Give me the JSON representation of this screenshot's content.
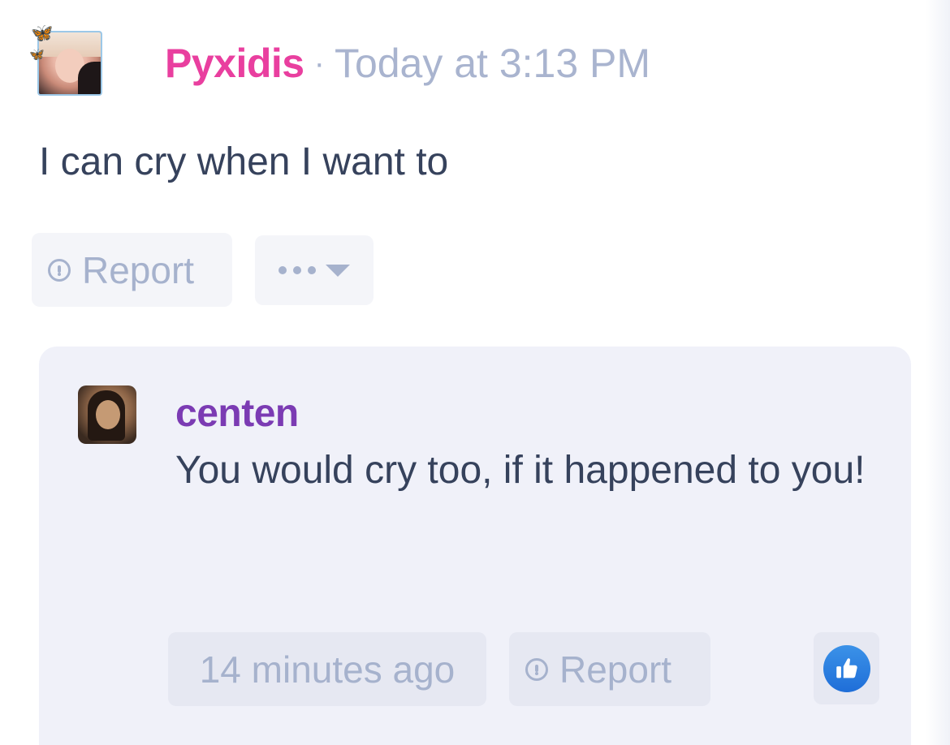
{
  "post": {
    "author": "Pyxidis",
    "separator": "·",
    "time": "Today at 3:13 PM",
    "body": "I can cry when I want to",
    "actions": {
      "report_label": "Report",
      "more_label": "•••"
    }
  },
  "reply": {
    "author": "centen",
    "body": "You would cry too, if it happened to you!",
    "time": "14 minutes ago",
    "report_label": "Report"
  },
  "colors": {
    "author_pink": "#e93f9f",
    "reply_author_purple": "#7b3bb3",
    "muted_text": "#a9b4cf",
    "body_text": "#36425c",
    "like_blue": "#2f83e3"
  },
  "icons": {
    "report": "alert-circle-icon",
    "more": "ellipsis-caret-icon",
    "like": "thumbs-up-icon",
    "decoration": "butterfly-icon"
  }
}
